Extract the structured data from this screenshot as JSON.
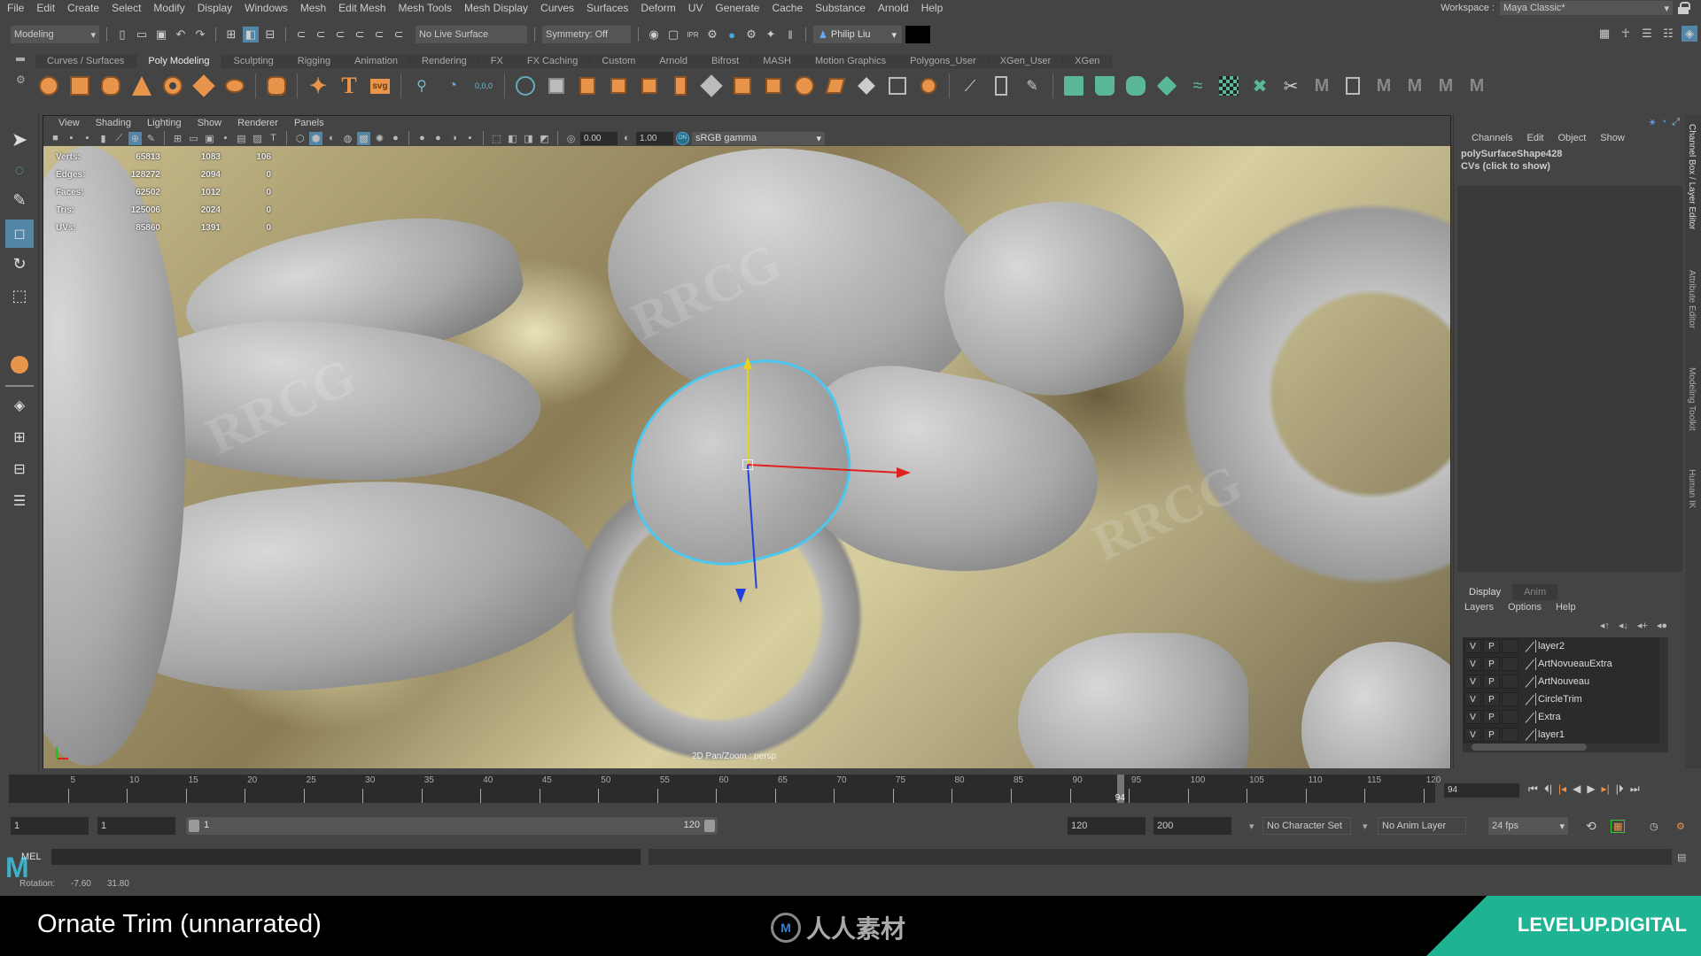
{
  "menubar": {
    "items": [
      "File",
      "Edit",
      "Create",
      "Select",
      "Modify",
      "Display",
      "Windows",
      "Mesh",
      "Edit Mesh",
      "Mesh Tools",
      "Mesh Display",
      "Curves",
      "Surfaces",
      "Deform",
      "UV",
      "Generate",
      "Cache",
      "Substance",
      "Arnold",
      "Help"
    ],
    "workspace_label": "Workspace :",
    "workspace_value": "Maya Classic*"
  },
  "statusline": {
    "mode": "Modeling",
    "live_surface": "No Live Surface",
    "symmetry": "Symmetry: Off",
    "user": "Philip Liu",
    "watermark_url": "www.rrcg.cn"
  },
  "shelf": {
    "tabs": [
      "Curves / Surfaces",
      "Poly Modeling",
      "Sculpting",
      "Rigging",
      "Animation",
      "Rendering",
      "FX",
      "FX Caching",
      "Custom",
      "Arnold",
      "Bifrost",
      "MASH",
      "Motion Graphics",
      "Polygons_User",
      "XGen_User",
      "XGen"
    ],
    "active_tab": "Poly Modeling"
  },
  "viewport": {
    "menu": [
      "View",
      "Shading",
      "Lighting",
      "Show",
      "Renderer",
      "Panels"
    ],
    "exposure": "0.00",
    "gamma": "1.00",
    "color_space": "sRGB gamma",
    "color_mgmt": "ON",
    "camera_label": "2D Pan/Zoom : persp",
    "hud": [
      {
        "label": "Verts:",
        "v1": "65813",
        "v2": "1083",
        "v3": "106"
      },
      {
        "label": "Edges:",
        "v1": "128272",
        "v2": "2094",
        "v3": "0"
      },
      {
        "label": "Faces:",
        "v1": "62502",
        "v2": "1012",
        "v3": "0"
      },
      {
        "label": "Tris:",
        "v1": "125006",
        "v2": "2024",
        "v3": "0"
      },
      {
        "label": "UVs:",
        "v1": "85860",
        "v2": "1391",
        "v3": "0"
      }
    ]
  },
  "channelbox": {
    "menu": [
      "Channels",
      "Edit",
      "Object",
      "Show"
    ],
    "object_name": "polySurfaceShape428",
    "cvs_label": "CVs (click to show)"
  },
  "layereditor": {
    "tabs": [
      "Display",
      "Anim"
    ],
    "active_tab": "Display",
    "menu": [
      "Layers",
      "Options",
      "Help"
    ],
    "layers": [
      {
        "v": "V",
        "p": "P",
        "name": "layer2"
      },
      {
        "v": "V",
        "p": "P",
        "name": "ArtNovueauExtra"
      },
      {
        "v": "V",
        "p": "P",
        "name": "ArtNouveau"
      },
      {
        "v": "V",
        "p": "P",
        "name": "CircleTrim"
      },
      {
        "v": "V",
        "p": "P",
        "name": "Extra"
      },
      {
        "v": "V",
        "p": "P",
        "name": "layer1"
      }
    ]
  },
  "side_tabs": [
    "Channel Box / Layer Editor",
    "Attribute Editor",
    "Modeling Toolkit",
    "Human IK"
  ],
  "timeline": {
    "ticks": [
      "5",
      "10",
      "15",
      "20",
      "25",
      "30",
      "35",
      "40",
      "45",
      "50",
      "55",
      "60",
      "65",
      "70",
      "75",
      "80",
      "85",
      "90",
      "95",
      "100",
      "105",
      "110",
      "115",
      "120"
    ],
    "range_start": 1,
    "range_end": 120,
    "current_frame": "94",
    "current_frame_field": "94"
  },
  "rangebar": {
    "start_time": "1",
    "playback_start": "1",
    "slider_start": "1",
    "slider_end": "120",
    "playback_end": "120",
    "end_time": "200",
    "character_set": "No Character Set",
    "anim_layer": "No Anim Layer",
    "fps": "24 fps"
  },
  "cmdline": {
    "lang": "MEL"
  },
  "helpline": {
    "label": "Rotation:",
    "v1": "-7.60",
    "v2": "31.80"
  },
  "caption": {
    "title": "Ornate Trim (unnarrated)",
    "center_brand": "人人素材",
    "brand": "LEVELUP.DIGITAL"
  },
  "colors": {
    "accent_blue": "#5285a6",
    "shelf_orange": "#e8944a",
    "shelf_green": "#5bb79a",
    "levelup_green": "#1fb393"
  }
}
